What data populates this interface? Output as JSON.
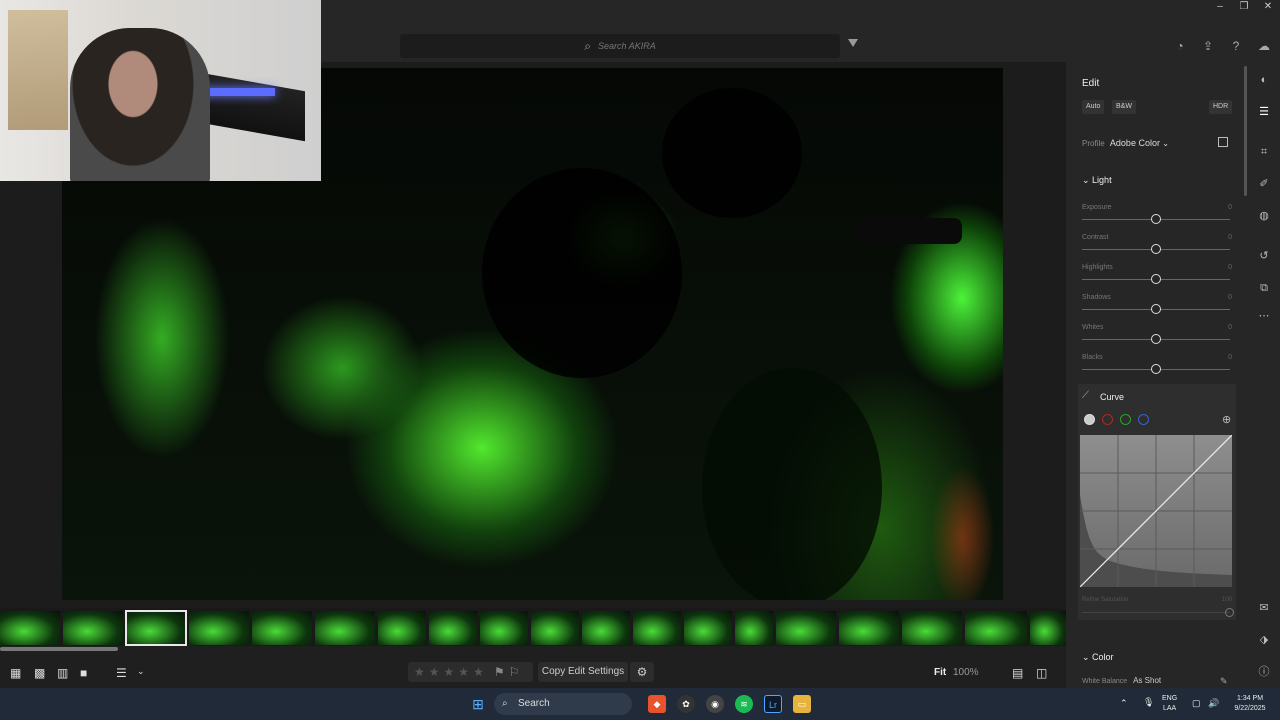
{
  "search": {
    "placeholder": "Search AKIRA"
  },
  "window_controls": {
    "minimize": "–",
    "restore": "❐",
    "close": "✕"
  },
  "top_icons": [
    "bell-icon",
    "share-icon",
    "help-icon",
    "cloud-icon"
  ],
  "edit_panel": {
    "title": "Edit",
    "auto_label": "Auto",
    "bw_label": "B&W",
    "hdr_label": "HDR",
    "profile_label": "Profile",
    "profile_value": "Adobe Color",
    "light_section": "Light",
    "sliders": [
      {
        "label": "Exposure",
        "value": "0",
        "position": 0.5
      },
      {
        "label": "Contrast",
        "value": "0",
        "position": 0.5
      },
      {
        "label": "Highlights",
        "value": "0",
        "position": 0.5
      },
      {
        "label": "Shadows",
        "value": "0",
        "position": 0.5
      },
      {
        "label": "Whites",
        "value": "0",
        "position": 0.5
      },
      {
        "label": "Blacks",
        "value": "0",
        "position": 0.5
      }
    ],
    "curve_title": "Curve",
    "refine_label": "Refine Saturation",
    "refine_value": "100",
    "color_section": "Color",
    "white_balance_label": "White Balance",
    "white_balance_value": "As Shot"
  },
  "bottom_toolbar": {
    "copy_edit_label": "Copy Edit Settings",
    "fit_label": "Fit",
    "zoom_label": "100%"
  },
  "taskbar": {
    "search_label": "Search",
    "lang_line1": "ENG",
    "lang_line2": "LAA",
    "time": "1:34 PM",
    "date": "9/22/2025",
    "app_lr_label": "Lr"
  }
}
